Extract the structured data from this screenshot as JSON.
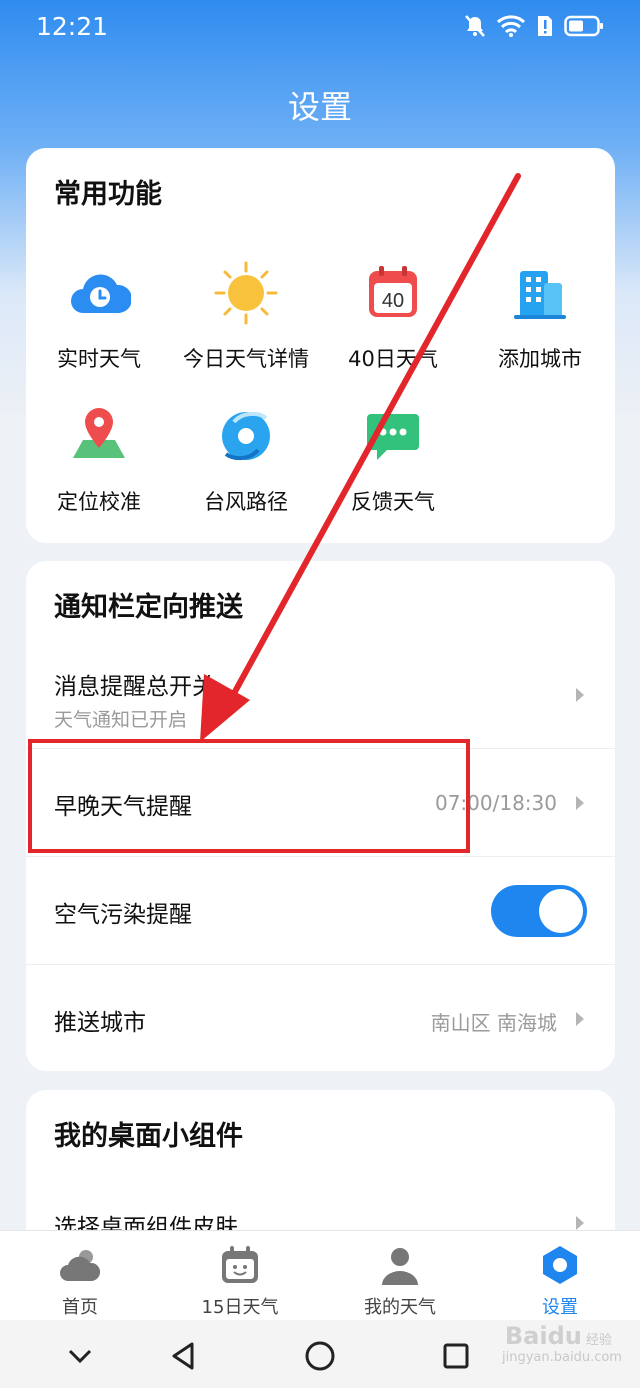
{
  "status_bar": {
    "time": "12:21"
  },
  "page_title": "设置",
  "common": {
    "title": "常用功能",
    "items": [
      {
        "label": "实时天气",
        "icon": "cloud-clock-icon"
      },
      {
        "label": "今日天气详情",
        "icon": "sun-icon"
      },
      {
        "label": "40日天气",
        "icon": "calendar-40-icon"
      },
      {
        "label": "添加城市",
        "icon": "building-icon"
      },
      {
        "label": "定位校准",
        "icon": "location-pin-icon"
      },
      {
        "label": "台风路径",
        "icon": "typhoon-icon"
      },
      {
        "label": "反馈天气",
        "icon": "chat-bubble-icon"
      }
    ],
    "calendar_number": "40"
  },
  "push": {
    "title": "通知栏定向推送",
    "master_switch": {
      "label": "消息提醒总开关",
      "sub": "天气通知已开启"
    },
    "morning_evening": {
      "label": "早晚天气提醒",
      "value": "07:00/18:30"
    },
    "air_pollution": {
      "label": "空气污染提醒",
      "enabled": true
    },
    "push_city": {
      "label": "推送城市",
      "value": "南山区 南海城"
    }
  },
  "widgets": {
    "title": "我的桌面小组件",
    "skin": {
      "label": "选择桌面组件皮肤"
    }
  },
  "tabs": [
    {
      "label": "首页",
      "icon": "cloud-sun-icon"
    },
    {
      "label": "15日天气",
      "icon": "calendar-face-icon"
    },
    {
      "label": "我的天气",
      "icon": "person-icon"
    },
    {
      "label": "设置",
      "icon": "hexagon-settings-icon",
      "active": true
    }
  ],
  "watermark": {
    "brand": "Bai",
    "brand2": "du",
    "sub": "经验",
    "url": "jingyan.baidu.com"
  },
  "colors": {
    "accent": "#1f86f0",
    "annotation_red": "#e3262c"
  }
}
